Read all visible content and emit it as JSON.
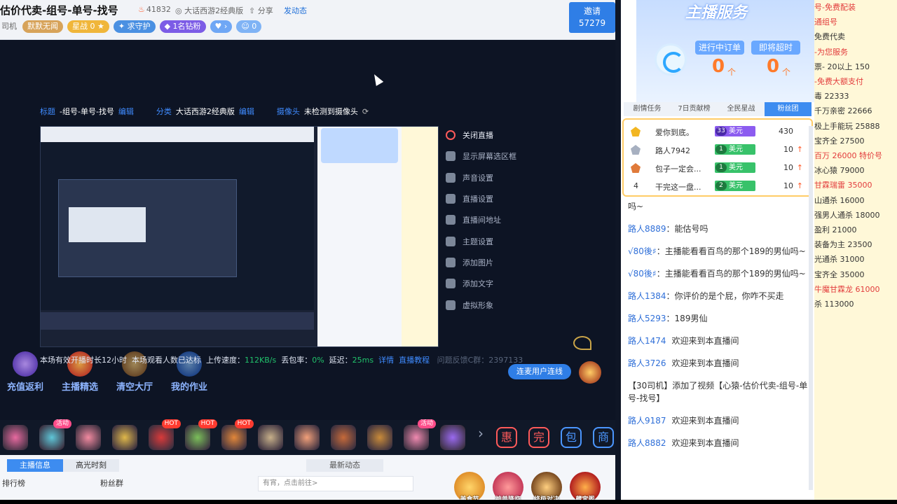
{
  "header": {
    "title": "估价代卖-组号-单号-找号",
    "hot_count": "41832",
    "category": "大话西游2经典版",
    "share": "分享",
    "publish_dynamic": "发动态",
    "badges": [
      "司机",
      "默默无闻",
      "星战",
      "0",
      "求守护",
      "1名钻粉",
      "0"
    ],
    "invite_label": "邀请",
    "invite_count": "57279"
  },
  "stream_settings": {
    "title_key": "标题",
    "title_value": "-组号-单号-找号",
    "edit": "编辑",
    "cat_key": "分类",
    "cat_value": "大话西游2经典版",
    "cam_key": "摄像头",
    "cam_value": "未检测到摄像头"
  },
  "side_menu": [
    {
      "label": "关闭直播",
      "icon": "power-icon"
    },
    {
      "label": "显示屏幕选区框",
      "icon": "monitor-icon"
    },
    {
      "label": "声音设置",
      "icon": "speaker-icon"
    },
    {
      "label": "直播设置",
      "icon": "sliders-icon"
    },
    {
      "label": "直播间地址",
      "icon": "location-icon"
    },
    {
      "label": "主题设置",
      "icon": "palette-icon"
    },
    {
      "label": "添加图片",
      "icon": "image-icon"
    },
    {
      "label": "添加文字",
      "icon": "text-icon"
    },
    {
      "label": "虚拟形象",
      "icon": "avatar-icon"
    }
  ],
  "stats": {
    "session": "本场有效开播时长12小时",
    "viewers": "本场观看人数已达标",
    "upload_label": "上传速度：",
    "upload_value": "112KB/s",
    "loss_label": "丢包率：",
    "loss_value": "0%",
    "delay_label": "延迟：",
    "delay_value": "25ms",
    "detail": "详情",
    "tutorial": "直播教程",
    "feedback": "问题反馈C群：2397133"
  },
  "actions": [
    "充值返利",
    "主播精选",
    "清空大厅",
    "我的作业"
  ],
  "link_button": "连麦用户连线",
  "gifts": [
    {
      "icon": "fish-icon",
      "tag": ""
    },
    {
      "icon": "crystal-icon",
      "tag": "活动"
    },
    {
      "icon": "egg-icon",
      "tag": ""
    },
    {
      "icon": "card-icon",
      "tag": ""
    },
    {
      "icon": "rose-icon",
      "tag": "HOT"
    },
    {
      "icon": "plant-icon",
      "tag": "HOT"
    },
    {
      "icon": "house-icon",
      "tag": "HOT"
    },
    {
      "icon": "cat-icon",
      "tag": ""
    },
    {
      "icon": "peach-icon",
      "tag": ""
    },
    {
      "icon": "crab-icon",
      "tag": ""
    },
    {
      "icon": "spoon-icon",
      "tag": ""
    },
    {
      "icon": "gown-icon",
      "tag": "活动"
    },
    {
      "icon": "quill-icon",
      "tag": ""
    }
  ],
  "gift_symbols": [
    "惠",
    "完",
    "包",
    "商"
  ],
  "bottom": {
    "tab_info": "主播信息",
    "tab_highlight": "高光时刻",
    "rank": "排行榜",
    "fans": "粉丝群",
    "news": "最新动态",
    "input_placeholder": "有宵，点击前往>",
    "big_icons": [
      "美食节",
      "神兽降临",
      "终极对决",
      "藏宝阁"
    ]
  },
  "service": {
    "title": "主播服务",
    "btn_progress": "进行中订单",
    "btn_timeout": "即将超时",
    "count_progress": "0",
    "count_timeout": "0",
    "unit": "个"
  },
  "right_tabs": [
    "剧情任务",
    "7日贡献榜",
    "全民星战",
    "粉丝团"
  ],
  "fan_list": [
    {
      "rank": "1",
      "name": "爱你到底。",
      "level": "33",
      "tier": "美元",
      "score": "430",
      "up": false
    },
    {
      "rank": "2",
      "name": "路人7942",
      "level": "1",
      "tier": "美元",
      "score": "10",
      "up": true
    },
    {
      "rank": "3",
      "name": "包子一定会...",
      "level": "1",
      "tier": "美元",
      "score": "10",
      "up": true
    },
    {
      "rank": "4",
      "name": "干完这一盘...",
      "level": "2",
      "tier": "美元",
      "score": "10",
      "up": true
    }
  ],
  "chat": [
    {
      "name": "",
      "text": "吗~"
    },
    {
      "name": "路人8889",
      "text": "：能估号吗"
    },
    {
      "name": "√80後♯",
      "text": "：主播能看看百鸟的那个189的男仙吗~"
    },
    {
      "name": "√80後♯",
      "text": "：主播能看看百鸟的那个189的男仙吗~"
    },
    {
      "name": "路人1384",
      "text": "：你评价的是个屁，你咋不买走"
    },
    {
      "name": "路人5293",
      "text": "：189男仙"
    },
    {
      "name": "路人1474",
      "text": "欢迎来到本直播间"
    },
    {
      "name": "路人3726",
      "text": "欢迎来到本直播间"
    },
    {
      "name": "",
      "text": "【30司机】添加了视频【心猿-估价代卖-组号-单号-找号】"
    },
    {
      "name": "路人9187",
      "text": "欢迎来到本直播间"
    },
    {
      "name": "路人8882",
      "text": "欢迎来到本直播间"
    }
  ],
  "far_list": [
    {
      "t": "号-免费配装",
      "red": true
    },
    {
      "t": "通组号",
      "red": true
    },
    {
      "t": "免费代卖",
      "red": false
    },
    {
      "t": "-为您服务",
      "red": true
    },
    {
      "t": "票- 20以上 150",
      "red": false
    },
    {
      "t": "-免费大额支付",
      "red": true
    },
    {
      "t": "毒 22333",
      "red": false
    },
    {
      "t": "千万亲密 22666",
      "red": false
    },
    {
      "t": "极上手能玩 25888",
      "red": false
    },
    {
      "t": "宝齐全 27500",
      "red": false
    },
    {
      "t": "百万 26000 特价号",
      "red": true
    },
    {
      "t": "冰心猿 79000",
      "red": false
    },
    {
      "t": "甘霖瑞雷 35000",
      "red": true
    },
    {
      "t": "山通杀 16000",
      "red": false
    },
    {
      "t": "强男人通杀 18000",
      "red": false
    },
    {
      "t": "盈利 21000",
      "red": false
    },
    {
      "t": "装备为主 23500",
      "red": false
    },
    {
      "t": "光通杀 31000",
      "red": false
    },
    {
      "t": "宝齐全 35000",
      "red": false
    },
    {
      "t": "牛魔甘霖龙 61000",
      "red": true
    },
    {
      "t": "杀 113000",
      "red": false
    }
  ]
}
